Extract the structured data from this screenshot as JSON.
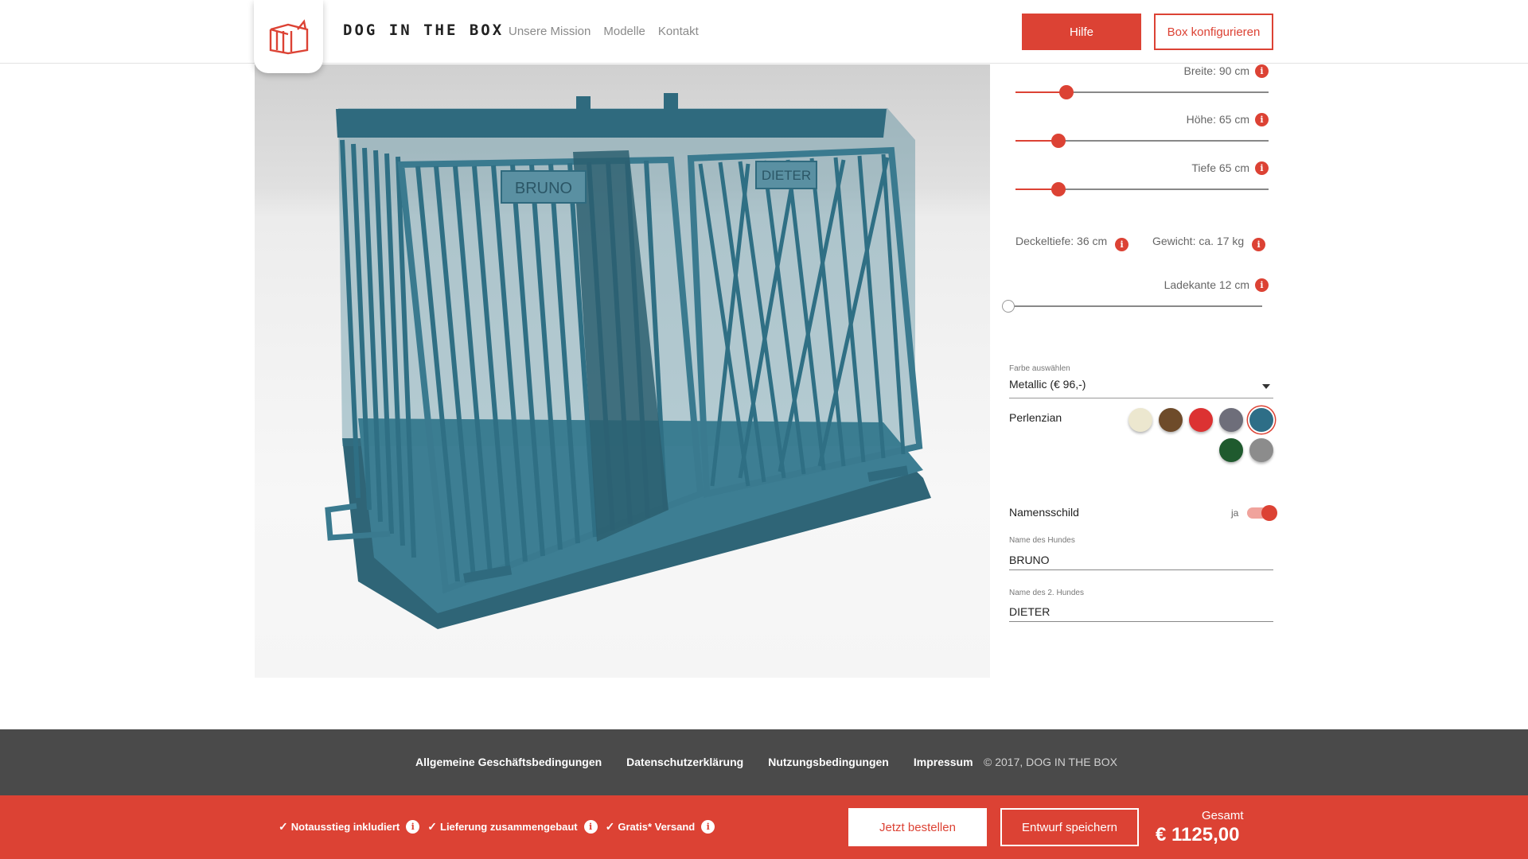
{
  "header": {
    "brand": "DOG IN THE BOX",
    "nav": [
      "Unsere Mission",
      "Modelle",
      "Kontakt"
    ],
    "help_label": "Hilfe",
    "configure_label": "Box konfigurieren"
  },
  "viewer": {
    "name_plate_1": "BRUNO",
    "name_plate_2": "DIETER",
    "box_color": "#3a7a8f"
  },
  "config": {
    "sliders": [
      {
        "label": "Breite: 90 cm",
        "value_percent": 20
      },
      {
        "label": "Höhe: 65 cm",
        "value_percent": 17
      },
      {
        "label": "Tiefe 65 cm",
        "value_percent": 17
      }
    ],
    "lid_depth": "Deckeltiefe: 36 cm",
    "weight": "Gewicht: ca. 17 kg",
    "loading_edge": {
      "label": "Ladekante 12 cm",
      "value_percent": 0
    },
    "color_caption": "Farbe auswählen",
    "color_select": "Metallic (€ 96,-)",
    "color_name": "Perlenzian",
    "swatches": [
      {
        "name": "cream",
        "hex": "#ece7cf"
      },
      {
        "name": "brown",
        "hex": "#6e4b2a"
      },
      {
        "name": "red",
        "hex": "#dc3232"
      },
      {
        "name": "grey-violet",
        "hex": "#6e6e7a"
      },
      {
        "name": "pearl-gentian",
        "hex": "#2e6e87",
        "selected": true
      },
      {
        "name": "green",
        "hex": "#1f5a2e"
      },
      {
        "name": "grey",
        "hex": "#8c8c8c"
      }
    ],
    "nameplate_label": "Namensschild",
    "nameplate_toggle": "ja",
    "dog1_caption": "Name des Hundes",
    "dog1_value": "BRUNO",
    "dog2_caption": "Name des 2. Hundes",
    "dog2_value": "DIETER"
  },
  "footer": {
    "links": [
      "Allgemeine Geschäftsbedingungen",
      "Datenschutzerklärung",
      "Nutzungsbedingungen",
      "Impressum"
    ],
    "copyright": "© 2017, DOG IN THE BOX"
  },
  "bar": {
    "features": [
      "Notausstieg inkludiert",
      "Lieferung zusammengebaut",
      "Gratis* Versand"
    ],
    "order_label": "Jetzt bestellen",
    "save_label": "Entwurf speichern",
    "total_label": "Gesamt",
    "total_value": "€ 1125,00"
  },
  "colors": {
    "accent": "#dc4234",
    "footer": "#4a4a4a"
  }
}
